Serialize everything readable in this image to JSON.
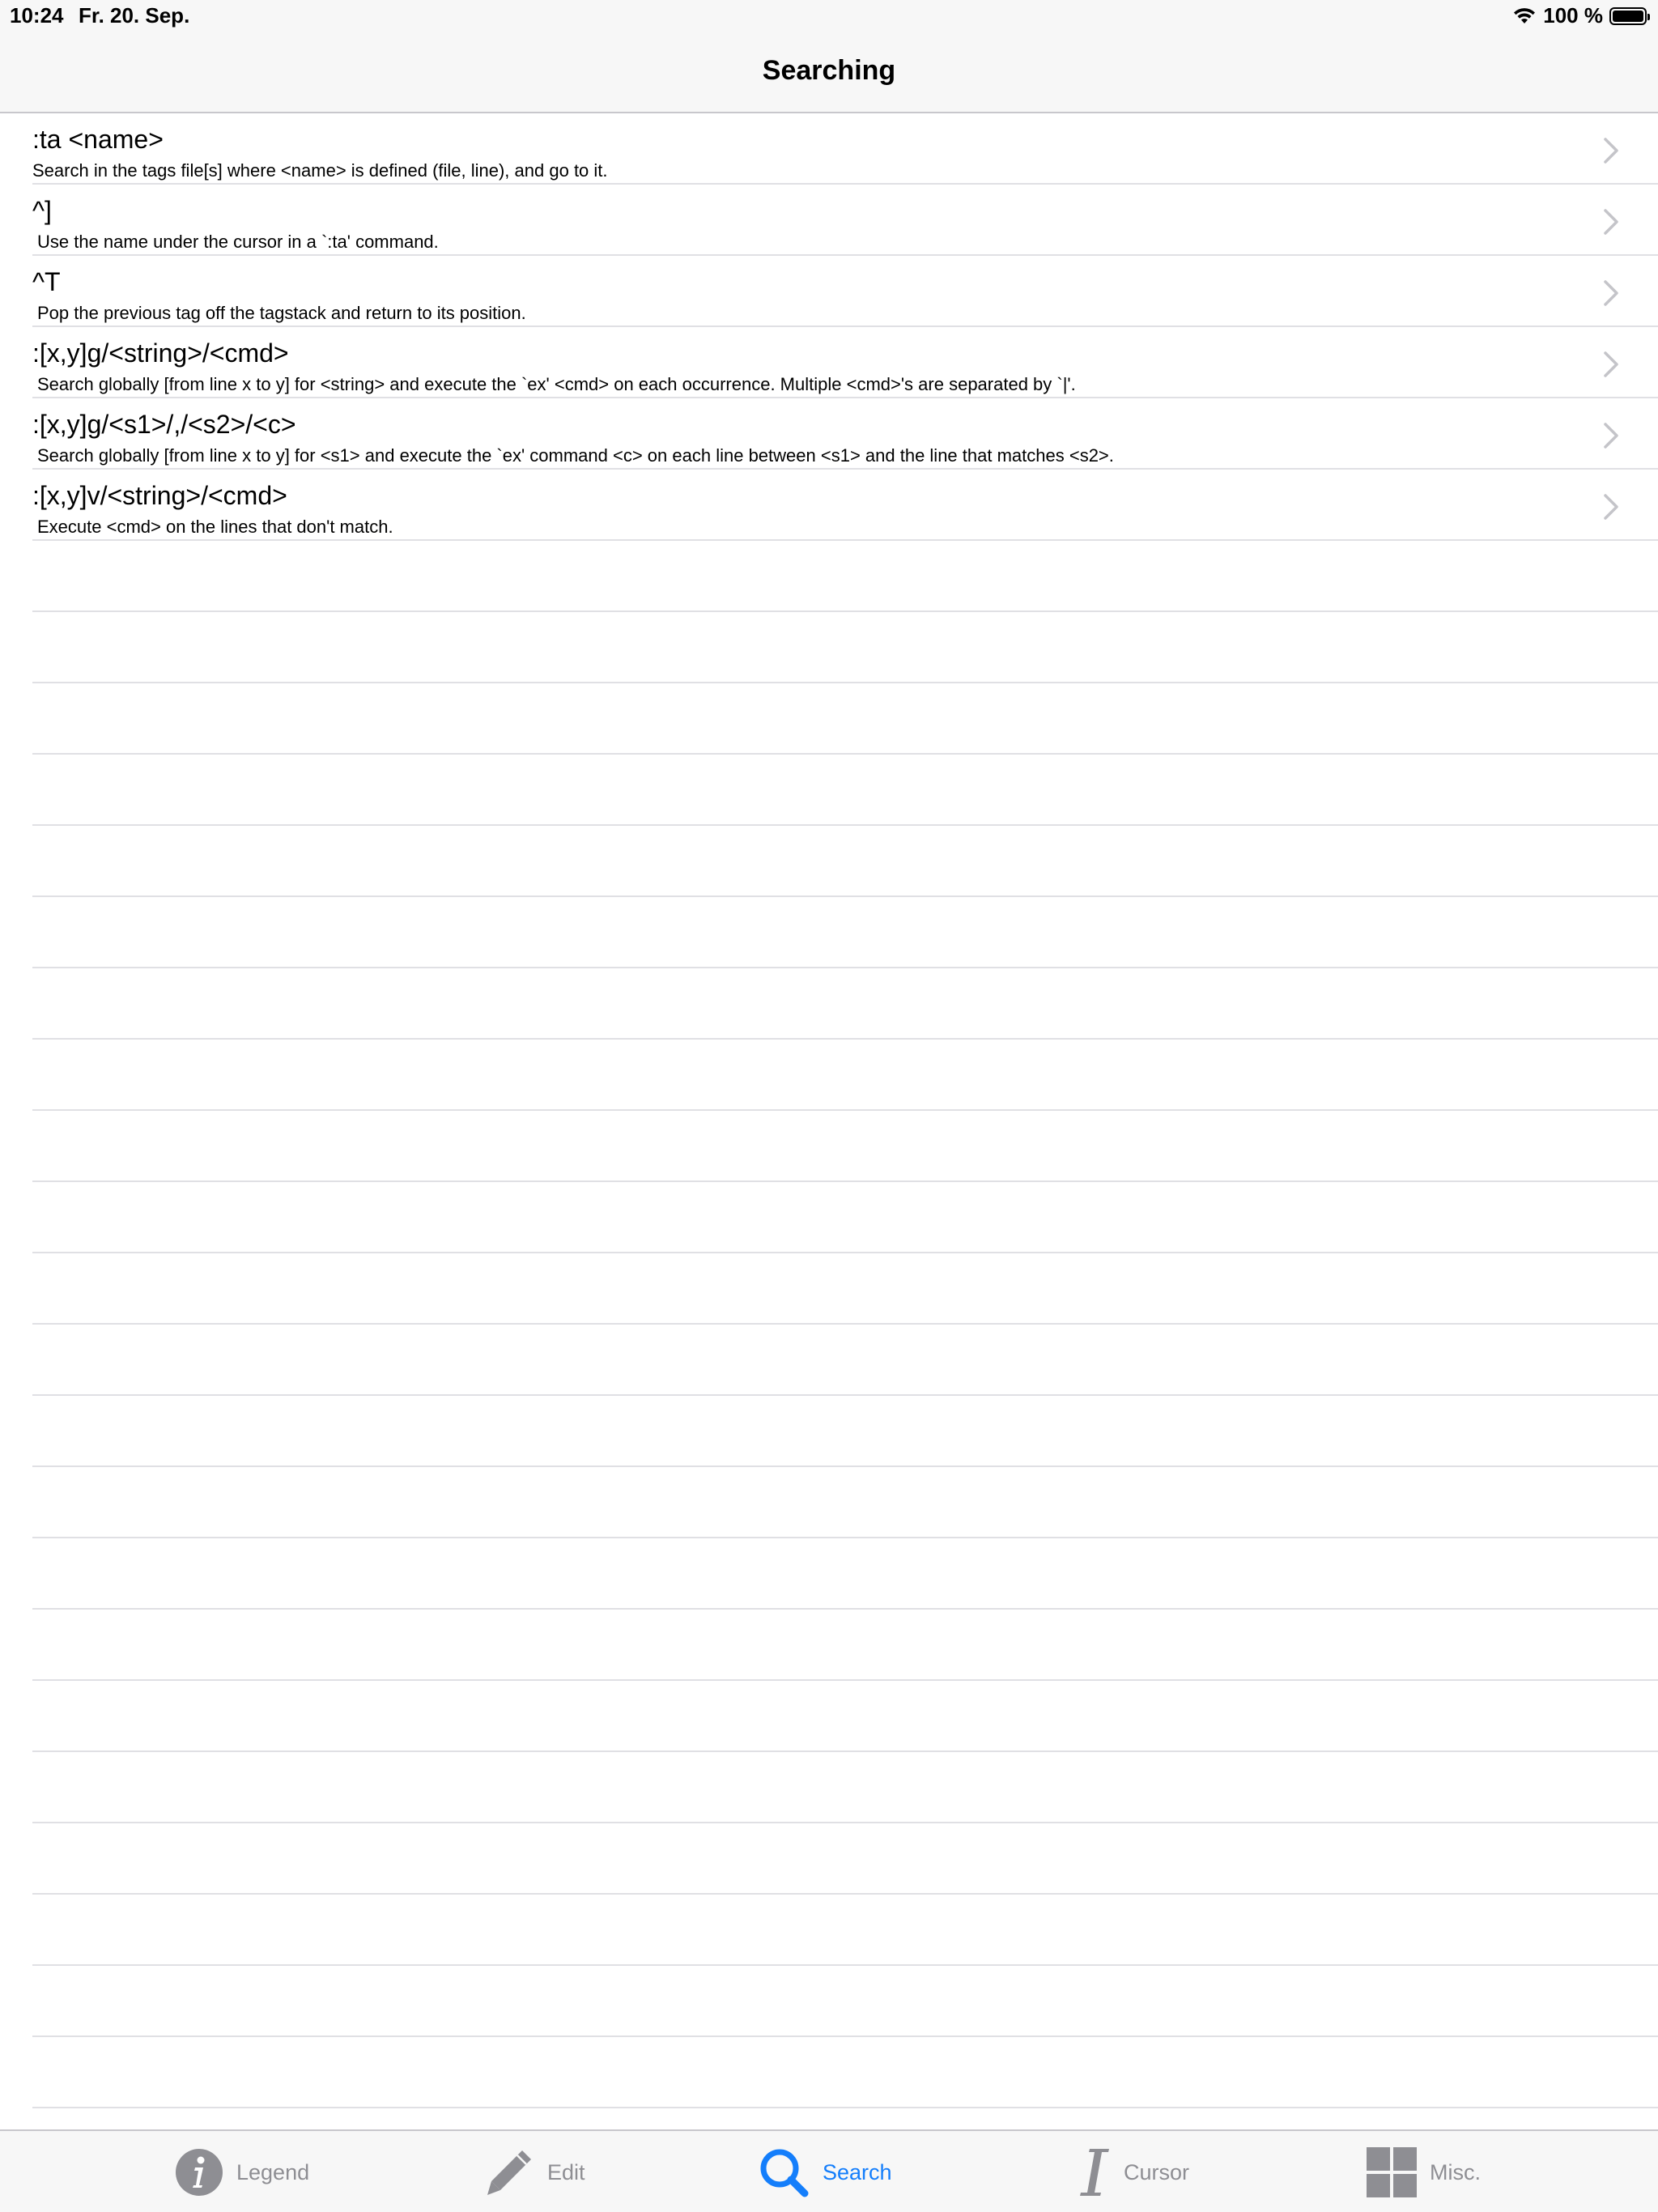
{
  "status_bar": {
    "time": "10:24",
    "date": "Fr. 20. Sep.",
    "battery": "100 %"
  },
  "nav": {
    "title": "Searching"
  },
  "rows": [
    {
      "title": ":ta <name>",
      "subtitle": "Search in the tags file[s] where <name> is defined (file, line), and go to it."
    },
    {
      "title": "^]",
      "subtitle": "Use the name under the cursor in a `:ta' command."
    },
    {
      "title": "^T",
      "subtitle": "Pop the previous tag off the tagstack and return to its position."
    },
    {
      "title": ":[x,y]g/<string>/<cmd>",
      "subtitle": "Search globally [from line x to y] for <string> and execute the `ex' <cmd> on each occurrence.  Multiple <cmd>'s are separated by `|'."
    },
    {
      "title": ":[x,y]g/<s1>/,/<s2>/<c>",
      "subtitle": "Search globally [from line x to y] for <s1> and execute the `ex' command <c> on each line between <s1> and the line that matches <s2>."
    },
    {
      "title": ":[x,y]v/<string>/<cmd>",
      "subtitle": "Execute <cmd> on the lines that don't match."
    }
  ],
  "tabs": [
    {
      "label": "Legend",
      "icon": "info-icon"
    },
    {
      "label": "Edit",
      "icon": "pencil-icon"
    },
    {
      "label": "Search",
      "icon": "magnifier-icon",
      "active": true
    },
    {
      "label": "Cursor",
      "icon": "text-cursor-icon"
    },
    {
      "label": "Misc.",
      "icon": "grid-icon"
    }
  ],
  "colors": {
    "accent": "#147efb",
    "tab_inactive": "#8e8e93",
    "separator": "#e0e0e4",
    "bar_background": "#f7f7f7"
  }
}
